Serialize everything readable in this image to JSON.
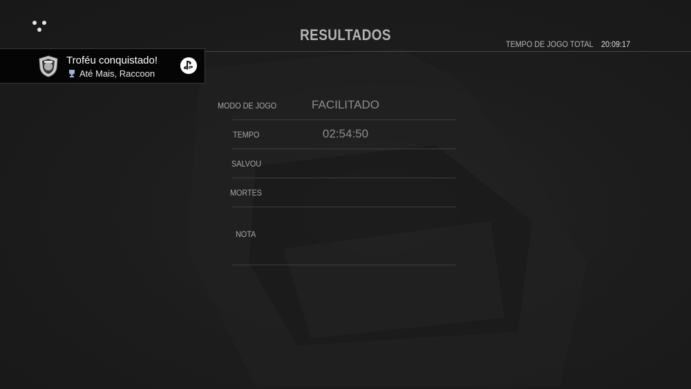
{
  "header": {
    "title": "RESULTADOS",
    "total_time_label": "TEMPO DE JOGO TOTAL",
    "total_time_value": "20:09:17"
  },
  "notification": {
    "title": "Troféu conquistado!",
    "trophy_name": "Até Mais, Raccoon",
    "icons": [
      "trophy-badge-icon",
      "bronze-trophy-icon",
      "playstation-icon"
    ]
  },
  "results": [
    {
      "label": "MODO DE JOGO",
      "value": "FACILITADO"
    },
    {
      "label": "TEMPO",
      "value": "02:54:50"
    },
    {
      "label": "SALVOU",
      "value": ""
    },
    {
      "label": "MORTES",
      "value": ""
    },
    {
      "label": "NOTA",
      "value": ""
    }
  ],
  "colors": {
    "background": "#1c1c1c",
    "title": "#b4b4b4",
    "toast_background": "#050505"
  }
}
